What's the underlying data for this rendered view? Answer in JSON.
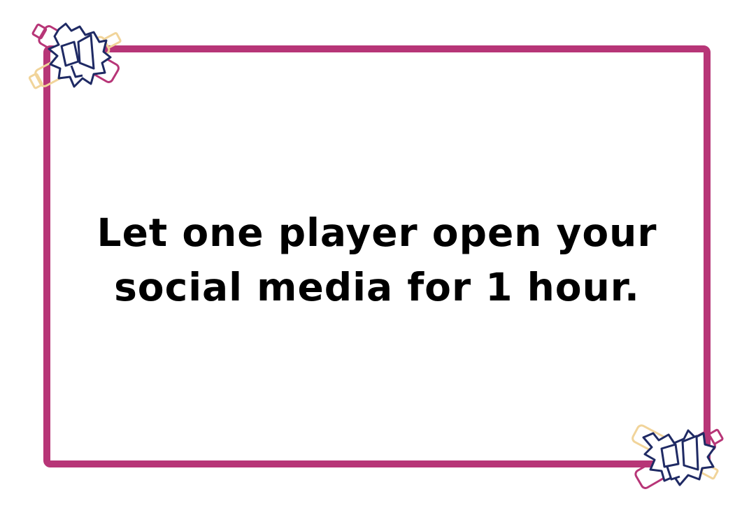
{
  "card": {
    "line1": "Let one player open your",
    "line2": "social media for 1 hour."
  },
  "colors": {
    "frame": "#b73577",
    "text": "#000000",
    "bottle_pink": "#b73577",
    "bottle_cream": "#f1d49a",
    "megaphone": "#1f2a64"
  },
  "icons": {
    "top_left": "bottles-megaphone-icon",
    "bottom_right": "bottles-megaphone-icon"
  }
}
